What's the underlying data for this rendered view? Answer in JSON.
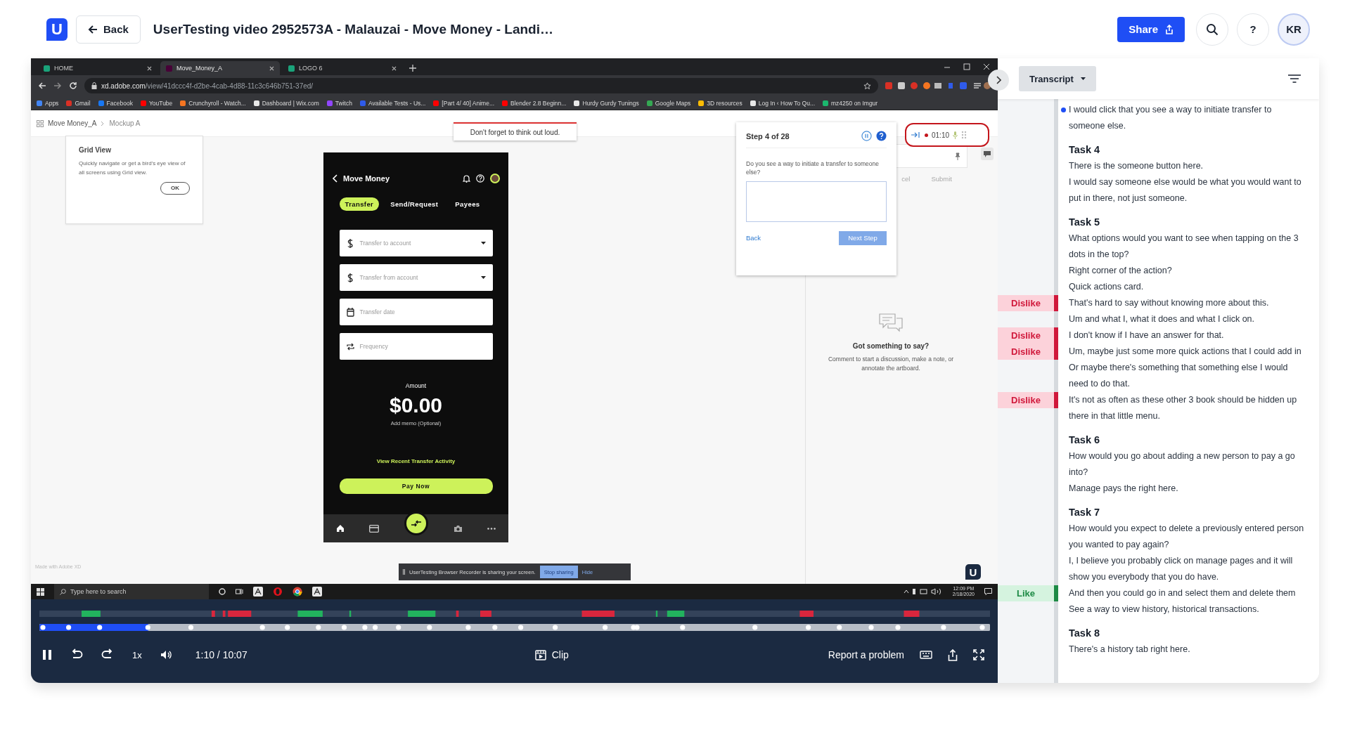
{
  "header": {
    "logo_letter": "U",
    "back_label": "Back",
    "title": "UserTesting video 2952573A - Malauzai - Move Money - Landi…",
    "share_label": "Share",
    "help_label": "?",
    "avatar_initials": "KR"
  },
  "video": {
    "browser": {
      "tabs": [
        {
          "label": "HOME",
          "selected": false,
          "color": "#1aa37a"
        },
        {
          "label": "Move_Money_A",
          "selected": true,
          "color": "#470137"
        },
        {
          "label": "LOGO 6",
          "selected": false,
          "color": "#1aa37a"
        }
      ],
      "url_host": "xd.adobe.com",
      "url_path": "/view/41dccc4f-d2be-4cab-4d88-11c3c646b751-37ed/",
      "bookmarks": [
        {
          "label": "Apps",
          "color": "#4285f4"
        },
        {
          "label": "Gmail",
          "color": "#d93025"
        },
        {
          "label": "Facebook",
          "color": "#1877f2"
        },
        {
          "label": "YouTube",
          "color": "#ff0000"
        },
        {
          "label": "Crunchyroll - Watch...",
          "color": "#f47521"
        },
        {
          "label": "Dashboard | Wix.com",
          "color": "#e8e8e8"
        },
        {
          "label": "Twitch",
          "color": "#9146ff"
        },
        {
          "label": "Available Tests - Us...",
          "color": "#2f5bea"
        },
        {
          "label": "[Part 4/ 40] Anime...",
          "color": "#ff0000"
        },
        {
          "label": "Blender 2.8 Beginn...",
          "color": "#ff0000"
        },
        {
          "label": "Hurdy Gurdy Tunings",
          "color": "#e8e8e8"
        },
        {
          "label": "Google Maps",
          "color": "#34a853"
        },
        {
          "label": "3D resources",
          "color": "#fbbc04"
        },
        {
          "label": "Log In ‹ How To Qu...",
          "color": "#e8e8e8"
        },
        {
          "label": "mz4250 on Imgur",
          "color": "#1bb76e"
        }
      ]
    },
    "xd": {
      "breadcrumb": [
        "Move Money_A",
        "Mockup A"
      ],
      "think_aloud": "Don't forget to think out loud.",
      "grid_view": {
        "title": "Grid View",
        "text": "Quickly navigate or get a bird's eye view of all screens using Grid view.",
        "ok": "OK"
      },
      "phone": {
        "title": "Move Money",
        "tabs": [
          {
            "label": "Transfer",
            "selected": true
          },
          {
            "label": "Send/Request",
            "selected": false
          },
          {
            "label": "Payees",
            "selected": false
          }
        ],
        "fields": [
          {
            "kind": "dollar",
            "placeholder": "Transfer to account",
            "dropdown": true
          },
          {
            "kind": "dollar",
            "placeholder": "Transfer from account",
            "dropdown": true
          },
          {
            "kind": "calendar",
            "placeholder": "Transfer date",
            "dropdown": false
          },
          {
            "kind": "repeat",
            "placeholder": "Frequency",
            "dropdown": false
          }
        ],
        "amount_label": "Amount",
        "amount": "$0.00",
        "memo": "Add memo (Optional)",
        "activity_link": "View Recent Transfer Activity",
        "pay_label": "Pay Now"
      },
      "step": {
        "title": "Step 4 of 28",
        "question": "Do you see a way to initiate a transfer to someone else?",
        "back": "Back",
        "next": "Next Step"
      },
      "recorder": {
        "time": "01:10"
      },
      "comments": {
        "cancel": "cel",
        "submit": "Submit",
        "title": "Got something to say?",
        "text": "Comment to start a discussion, make a note, or annotate the artboard."
      },
      "made_with": "Made with Adobe XD",
      "share_bar": {
        "text": "UserTesting Browser Recorder is sharing your screen.",
        "stop": "Stop sharing",
        "hide": "Hide"
      },
      "badge_letter": "U"
    },
    "taskbar": {
      "search_placeholder": "Type here to search",
      "time": "12:09 PM",
      "date": "2/18/2020"
    }
  },
  "player": {
    "progress": {
      "level": 0.115
    },
    "playing": true,
    "speed": "1x",
    "time": "1:10 / 10:07",
    "clip": "Clip",
    "report": "Report a problem"
  },
  "transcript": {
    "view": "Transcript",
    "items": [
      {
        "kind": "line",
        "text": "I would click that you see a way to initiate transfer to someone else.",
        "current": true
      },
      {
        "kind": "heading",
        "text": "Task 4"
      },
      {
        "kind": "line",
        "text": "There is the someone button here.",
        "current": false
      },
      {
        "kind": "line",
        "text": "I would say someone else would be what you would want to put in there, not just someone.",
        "current": false
      },
      {
        "kind": "heading",
        "text": "Task 5"
      },
      {
        "kind": "line",
        "text": "What options would you want to see when tapping on the 3 dots in the top?",
        "current": false
      },
      {
        "kind": "line",
        "text": "Right corner of the action?",
        "current": false
      },
      {
        "kind": "line",
        "text": "Quick actions card.",
        "current": false
      },
      {
        "kind": "line",
        "text": "That's hard to say without knowing more about this.",
        "current": false,
        "tag": {
          "label": "Dislike",
          "kind": "negative"
        }
      },
      {
        "kind": "line",
        "text": "Um and what I, what it does and what I click on.",
        "current": false
      },
      {
        "kind": "line",
        "text": "I don't know if I have an answer for that.",
        "current": false,
        "tag": {
          "label": "Dislike",
          "kind": "negative"
        }
      },
      {
        "kind": "line",
        "text": "Um, maybe just some more quick actions that I could add in Or maybe there's something that something else I would need to do that.",
        "current": false,
        "tag": {
          "label": "Dislike",
          "kind": "negative"
        }
      },
      {
        "kind": "line",
        "text": "It's not as often as these other 3 book should be hidden up there in that little menu.",
        "current": false,
        "tag": {
          "label": "Dislike",
          "kind": "negative"
        }
      },
      {
        "kind": "heading",
        "text": "Task 6"
      },
      {
        "kind": "line",
        "text": "How would you go about adding a new person to pay a go into?",
        "current": false
      },
      {
        "kind": "line",
        "text": "Manage pays the right here.",
        "current": false
      },
      {
        "kind": "heading",
        "text": "Task 7"
      },
      {
        "kind": "line",
        "text": "How would you expect to delete a previously entered person you wanted to pay again?",
        "current": false
      },
      {
        "kind": "line",
        "text": "I, I believe you probably click on manage pages and it will show you everybody that you do have.",
        "current": false
      },
      {
        "kind": "line",
        "text": "And then you could go in and select them and delete them",
        "current": false,
        "tag": {
          "label": "Like",
          "kind": "positive"
        }
      },
      {
        "kind": "line",
        "text": "See a way to view history, historical transactions.",
        "current": false
      },
      {
        "kind": "heading",
        "text": "Task 8"
      },
      {
        "kind": "line",
        "text": "There's a history tab right here.",
        "current": false
      }
    ]
  }
}
